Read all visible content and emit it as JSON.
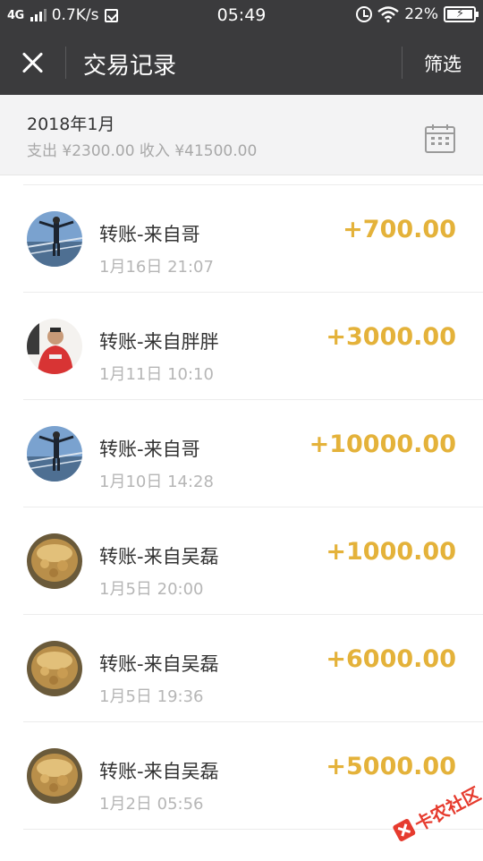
{
  "status_bar": {
    "network": "4G",
    "speed": "0.7K/s",
    "time": "05:49",
    "battery": "22%"
  },
  "header": {
    "title": "交易记录",
    "filter_label": "筛选"
  },
  "month": {
    "title": "2018年1月",
    "summary": "支出 ¥2300.00 收入 ¥41500.00"
  },
  "transactions": [
    {
      "title": "转账-来自哥",
      "time": "1月16日 21:07",
      "amount": "+700.00",
      "avatar": "man-on-pier"
    },
    {
      "title": "转账-来自胖胖",
      "time": "1月11日 10:10",
      "amount": "+3000.00",
      "avatar": "man-red-shirt"
    },
    {
      "title": "转账-来自哥",
      "time": "1月10日 14:28",
      "amount": "+10000.00",
      "avatar": "man-on-pier"
    },
    {
      "title": "转账-来自吴磊",
      "time": "1月5日 20:00",
      "amount": "+1000.00",
      "avatar": "golden-pot"
    },
    {
      "title": "转账-来自吴磊",
      "time": "1月5日 19:36",
      "amount": "+6000.00",
      "avatar": "golden-pot"
    },
    {
      "title": "转账-来自吴磊",
      "time": "1月2日 05:56",
      "amount": "+5000.00",
      "avatar": "golden-pot"
    }
  ],
  "watermark": {
    "text": "卡农社区"
  },
  "colors": {
    "header_bg": "#3b3b3d",
    "amount": "#e4b23a",
    "section_bg": "#f3f3f4"
  }
}
